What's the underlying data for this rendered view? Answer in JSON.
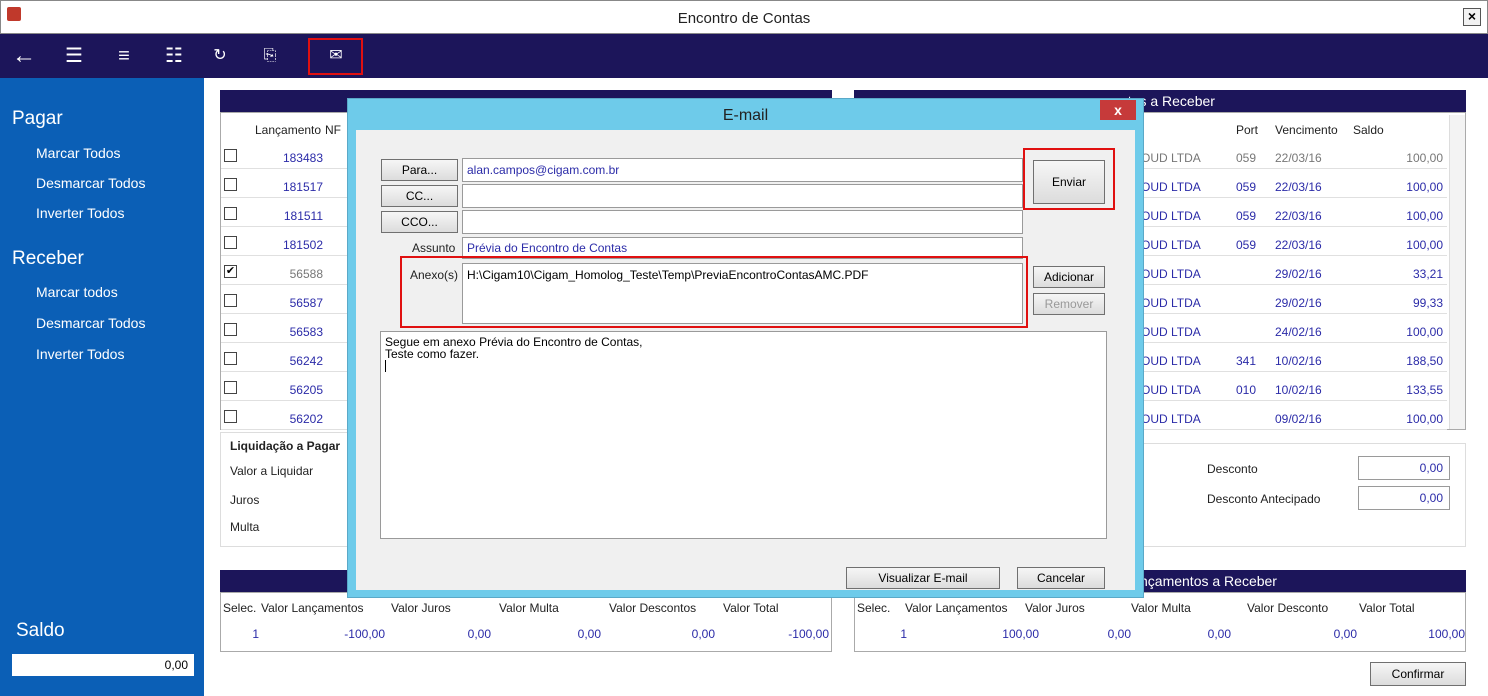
{
  "window": {
    "title": "Encontro de Contas",
    "close": "×"
  },
  "sidebar": {
    "pagar": {
      "title": "Pagar",
      "items": [
        "Marcar Todos",
        "Desmarcar Todos",
        "Inverter Todos"
      ]
    },
    "receber": {
      "title": "Receber",
      "items": [
        "Marcar todos",
        "Desmarcar Todos",
        "Inverter Todos"
      ]
    },
    "saldo_label": "Saldo",
    "saldo_value": "0,00"
  },
  "toolbar": {
    "icons": [
      "back-arrow-icon",
      "checklist-icon",
      "list-icon",
      "filter-list-icon",
      "refresh-icon",
      "clipboard-icon",
      "email-list-icon"
    ]
  },
  "left_panel": {
    "headers": {
      "lancamento": "Lançamento",
      "nf": "NF"
    },
    "rows": [
      {
        "checked": false,
        "lancamento": "183483"
      },
      {
        "checked": false,
        "lancamento": "181517"
      },
      {
        "checked": false,
        "lancamento": "181511"
      },
      {
        "checked": false,
        "lancamento": "181502"
      },
      {
        "checked": true,
        "lancamento": "56588"
      },
      {
        "checked": false,
        "lancamento": "56587"
      },
      {
        "checked": false,
        "lancamento": "56583"
      },
      {
        "checked": false,
        "lancamento": "56242"
      },
      {
        "checked": false,
        "lancamento": "56205"
      },
      {
        "checked": false,
        "lancamento": "56202"
      }
    ]
  },
  "right_panel": {
    "title_fragment": "ntos a Receber",
    "headers": {
      "port": "Port",
      "vencimento": "Vencimento",
      "saldo": "Saldo"
    },
    "rows": [
      {
        "cliente": "OUD LTDA",
        "port": "059",
        "vencimento": "22/03/16",
        "saldo": "100,00"
      },
      {
        "cliente": "OUD LTDA",
        "port": "059",
        "vencimento": "22/03/16",
        "saldo": "100,00"
      },
      {
        "cliente": "OUD LTDA",
        "port": "059",
        "vencimento": "22/03/16",
        "saldo": "100,00"
      },
      {
        "cliente": "OUD LTDA",
        "port": "059",
        "vencimento": "22/03/16",
        "saldo": "100,00"
      },
      {
        "cliente": "OUD LTDA",
        "port": "",
        "vencimento": "29/02/16",
        "saldo": "33,21"
      },
      {
        "cliente": "OUD LTDA",
        "port": "",
        "vencimento": "29/02/16",
        "saldo": "99,33"
      },
      {
        "cliente": "OUD LTDA",
        "port": "",
        "vencimento": "24/02/16",
        "saldo": "100,00"
      },
      {
        "cliente": "OUD LTDA",
        "port": "341",
        "vencimento": "10/02/16",
        "saldo": "188,50"
      },
      {
        "cliente": "OUD LTDA",
        "port": "010",
        "vencimento": "10/02/16",
        "saldo": "133,55"
      },
      {
        "cliente": "OUD LTDA",
        "port": "",
        "vencimento": "09/02/16",
        "saldo": "100,00"
      }
    ]
  },
  "liquidacao": {
    "title": "Liquidação a Pagar",
    "valor": "Valor a Liquidar",
    "juros": "Juros",
    "multa": "Multa"
  },
  "desconto": {
    "desconto_label": "Desconto",
    "desconto_value": "0,00",
    "antecipado_label": "Desconto Antecipado",
    "antecipado_value": "0,00"
  },
  "totals_left": {
    "headers": [
      "Selec.",
      "Valor Lançamentos",
      "Valor Juros",
      "Valor Multa",
      "Valor Descontos",
      "Valor Total"
    ],
    "values": [
      "1",
      "-100,00",
      "0,00",
      "0,00",
      "0,00",
      "-100,00"
    ]
  },
  "totals_right": {
    "title_fragment": "nçamentos a Receber",
    "headers": [
      "Selec.",
      "Valor Lançamentos",
      "Valor Juros",
      "Valor Multa",
      "Valor Desconto",
      "Valor Total"
    ],
    "values": [
      "1",
      "100,00",
      "0,00",
      "0,00",
      "0,00",
      "100,00"
    ]
  },
  "confirmar": "Confirmar",
  "dialog": {
    "title": "E-mail",
    "close": "x",
    "para_button": "Para...",
    "para_value": "alan.campos@cigam.com.br",
    "cc_button": "CC...",
    "cc_value": "",
    "cco_button": "CCO...",
    "cco_value": "",
    "assunto_label": "Assunto",
    "assunto_value": "Prévia do Encontro de Contas",
    "anexo_label": "Anexo(s)",
    "anexo_value": "H:\\Cigam10\\Cigam_Homolog_Teste\\Temp\\PreviaEncontroContasAMC.PDF",
    "enviar": "Enviar",
    "adicionar": "Adicionar",
    "remover": "Remover",
    "body_line1": "Segue em anexo Prévia do Encontro de Contas,",
    "body_line2": "Teste como fazer.",
    "visualizar": "Visualizar E-mail",
    "cancelar": "Cancelar"
  }
}
